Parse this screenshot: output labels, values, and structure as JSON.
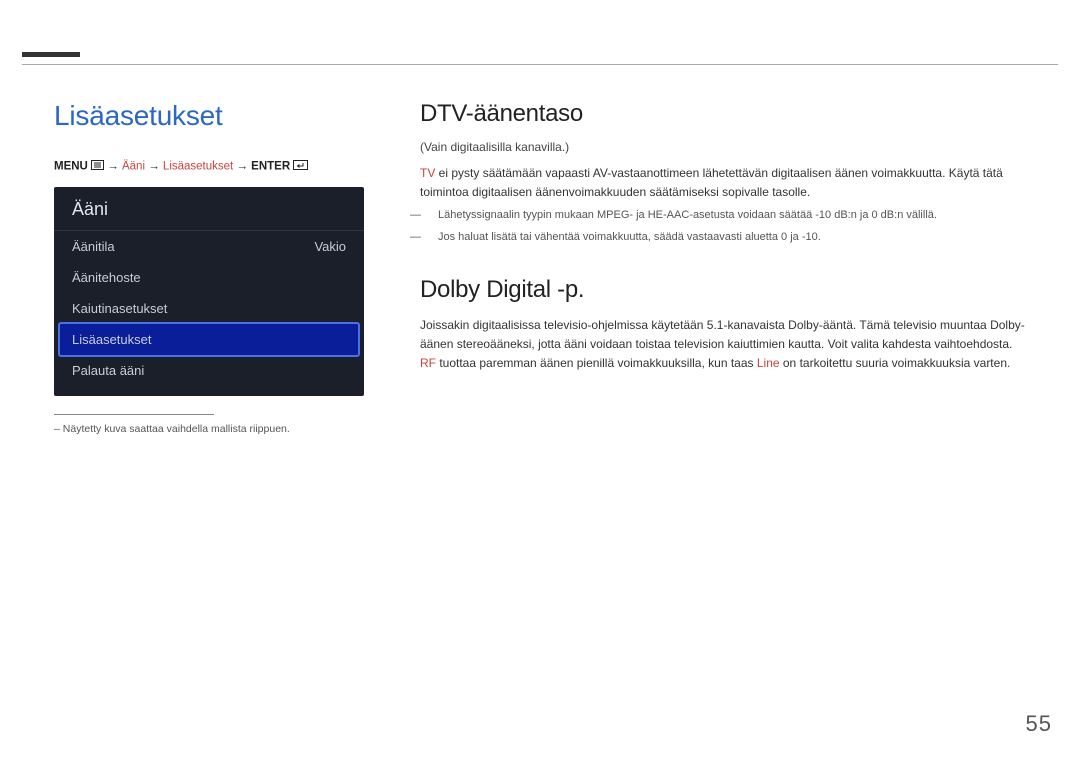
{
  "page_title": "Lisäasetukset",
  "breadcrumb": {
    "menu": "MENU",
    "arrow": "→",
    "part_accent": "Ääni",
    "part2": "Lisäasetukset",
    "enter": "ENTER"
  },
  "menu_panel": {
    "title": "Ääni",
    "items": [
      {
        "label": "Äänitila",
        "value": "Vakio",
        "selected": false
      },
      {
        "label": "Äänitehoste",
        "value": "",
        "selected": false
      },
      {
        "label": "Kaiutinasetukset",
        "value": "",
        "selected": false
      },
      {
        "label": "Lisäasetukset",
        "value": "",
        "selected": true
      },
      {
        "label": "Palauta ääni",
        "value": "",
        "selected": false
      }
    ]
  },
  "left_footnote_prefix": "–",
  "left_footnote": "Näytetty kuva saattaa vaihdella mallista riippuen.",
  "right": {
    "s1_heading": "DTV-äänentaso",
    "s1_paren": "(Vain digitaalisilla kanavilla.)",
    "s1_body_tv": "TV",
    "s1_body_rest": " ei pysty säätämään vapaasti AV-vastaanottimeen lähetettävän digitaalisen äänen voimakkuutta. Käytä tätä toimintoa digitaalisen äänenvoimakkuuden säätämiseksi sopivalle tasolle.",
    "s1_note1": "Lähetyssignaalin tyypin mukaan MPEG- ja HE-AAC-asetusta voidaan säätää -10 dB:n ja 0 dB:n välillä.",
    "s1_note2": "Jos haluat lisätä tai vähentää voimakkuutta, säädä vastaavasti aluetta 0 ja -10.",
    "s2_heading": "Dolby Digital -p.",
    "s2_body_a": "Joissakin digitaalisissa televisio-ohjelmissa käytetään 5.1-kanavaista Dolby-ääntä. Tämä televisio muuntaa Dolby-äänen stereoääneksi, jotta ääni voidaan toistaa television kaiuttimien kautta. Voit valita kahdesta vaihtoehdosta.",
    "s2_rf": "RF",
    "s2_body_b": " tuottaa paremman äänen pienillä voimakkuuksilla, kun taas ",
    "s2_line": "Line",
    "s2_body_c": " on tarkoitettu suuria voimakkuuksia varten."
  },
  "page_number": "55"
}
